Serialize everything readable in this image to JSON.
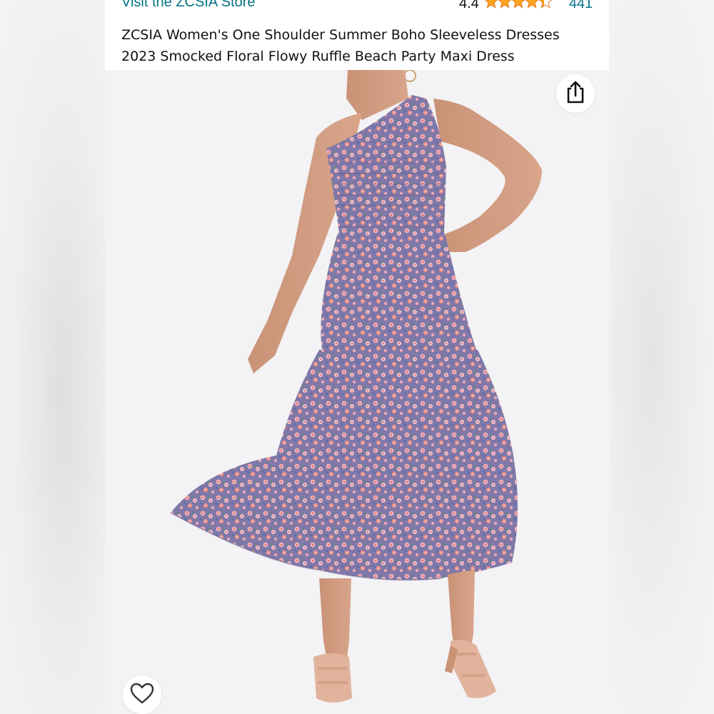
{
  "store": {
    "link_label": "Visit the ZCSIA Store"
  },
  "rating": {
    "value": "4.4",
    "stars_filled": 4.4,
    "stars_max": 5,
    "review_count": "441",
    "star_color": "#ffa41c"
  },
  "product": {
    "title": "ZCSIA Women's One Shoulder Summer Boho Sleeveless Dresses 2023 Smocked Floral Flowy Ruffle Beach Party Maxi Dress"
  },
  "image": {
    "alt_icon": "product-photo",
    "dress_colors": [
      "#8a7ea8",
      "#e69aa8",
      "#5a6aa8",
      "#d98f6a"
    ]
  },
  "actions": {
    "share_icon": "share-icon",
    "favorite_icon": "heart-icon"
  },
  "colors": {
    "link": "#007185",
    "text": "#0f1111"
  }
}
